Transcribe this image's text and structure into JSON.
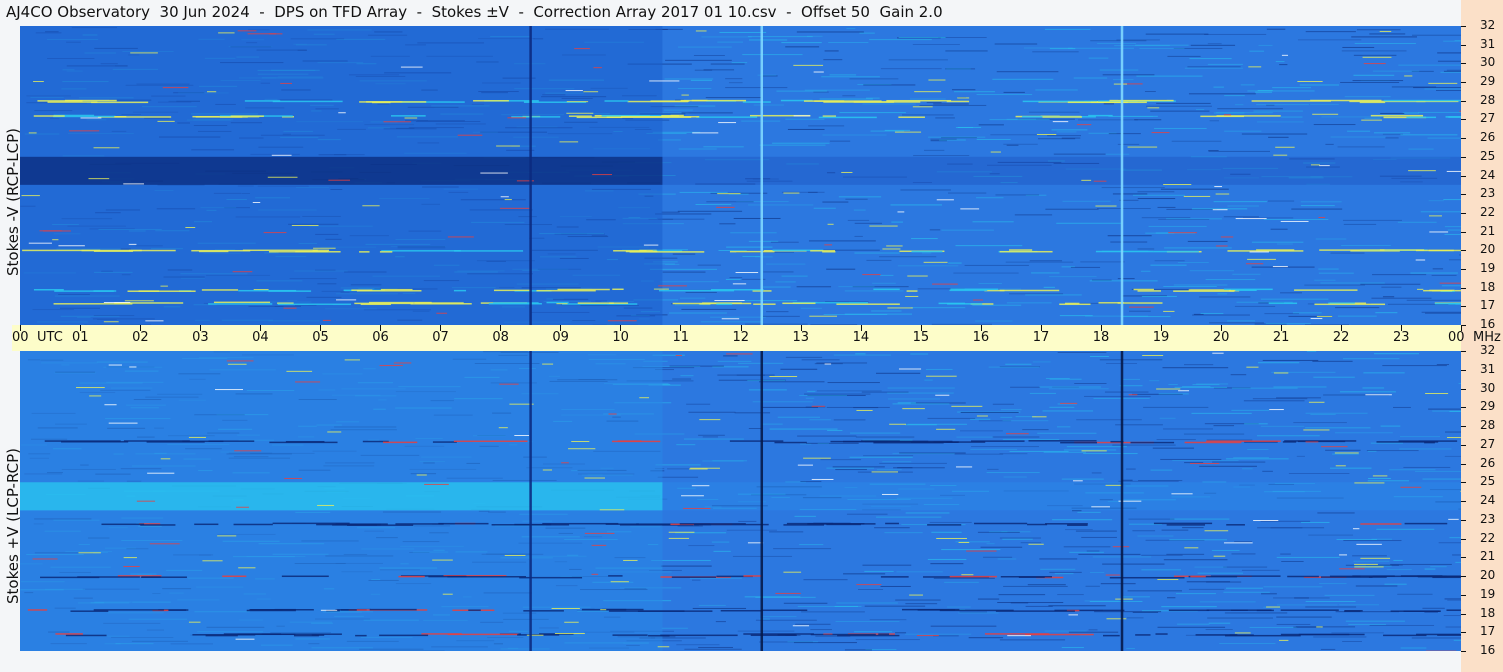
{
  "title": "AJ4CO Observatory  30 Jun 2024  -  DPS on TFD Array  -  Stokes ±V  -  Correction Array 2017 01 10.csv  -  Offset 50  Gain 2.0",
  "panels": {
    "top_label": "Stokes -V (RCP-LCP)",
    "bottom_label": "Stokes +V (LCP-RCP)"
  },
  "colors": {
    "background": "#2c78e0",
    "dark": "#0a2a7a",
    "bright": "#29c8f0",
    "highlight": "#e8f05a",
    "hot": "#e84040",
    "time_band": "#fdfdc9",
    "freq_strip": "#fbe0c8"
  },
  "chart_data": [
    {
      "type": "heatmap",
      "name": "Stokes -V (RCP-LCP)",
      "ylabel": "Stokes -V (RCP-LCP)",
      "x_unit": "UTC",
      "y_unit": "MHz",
      "xlim": [
        0,
        24
      ],
      "ylim": [
        16,
        32
      ],
      "x_ticks": [
        "00",
        "01",
        "02",
        "03",
        "04",
        "05",
        "06",
        "07",
        "08",
        "09",
        "10",
        "11",
        "12",
        "13",
        "14",
        "15",
        "16",
        "17",
        "18",
        "19",
        "20",
        "21",
        "22",
        "23",
        "00"
      ],
      "y_ticks": [
        "16",
        "17",
        "18",
        "19",
        "20",
        "21",
        "22",
        "23",
        "24",
        "25",
        "26",
        "27",
        "28",
        "29",
        "30",
        "31",
        "32"
      ],
      "features": {
        "dark_band_mhz": [
          23.5,
          25
        ],
        "dark_band_until_utc": 10.7,
        "vertical_line_utc": [
          8.5,
          12.35,
          18.35
        ],
        "bright_rows_mhz": [
          17.2,
          17.9,
          20.0,
          27.2,
          28.0
        ]
      }
    },
    {
      "type": "heatmap",
      "name": "Stokes +V (LCP-RCP)",
      "ylabel": "Stokes +V (LCP-RCP)",
      "x_unit": "UTC",
      "y_unit": "MHz",
      "xlim": [
        0,
        24
      ],
      "ylim": [
        16,
        32
      ],
      "x_ticks": [
        "00",
        "01",
        "02",
        "03",
        "04",
        "05",
        "06",
        "07",
        "08",
        "09",
        "10",
        "11",
        "12",
        "13",
        "14",
        "15",
        "16",
        "17",
        "18",
        "19",
        "20",
        "21",
        "22",
        "23",
        "00"
      ],
      "y_ticks": [
        "16",
        "17",
        "18",
        "19",
        "20",
        "21",
        "22",
        "23",
        "24",
        "25",
        "26",
        "27",
        "28",
        "29",
        "30",
        "31",
        "32"
      ],
      "features": {
        "bright_band_mhz": [
          23.5,
          25
        ],
        "bright_band_until_utc": 10.7,
        "vertical_line_utc": [
          8.5,
          12.35,
          18.35
        ],
        "dark_rows_mhz": [
          16.9,
          18.2,
          20.0,
          22.8,
          27.2
        ]
      }
    }
  ],
  "time_axis": {
    "labels": [
      "00",
      "01",
      "02",
      "03",
      "04",
      "05",
      "06",
      "07",
      "08",
      "09",
      "10",
      "11",
      "12",
      "13",
      "14",
      "15",
      "16",
      "17",
      "18",
      "19",
      "20",
      "21",
      "22",
      "23",
      "00"
    ],
    "utc_label": "UTC",
    "mhz_label": "MHz"
  }
}
